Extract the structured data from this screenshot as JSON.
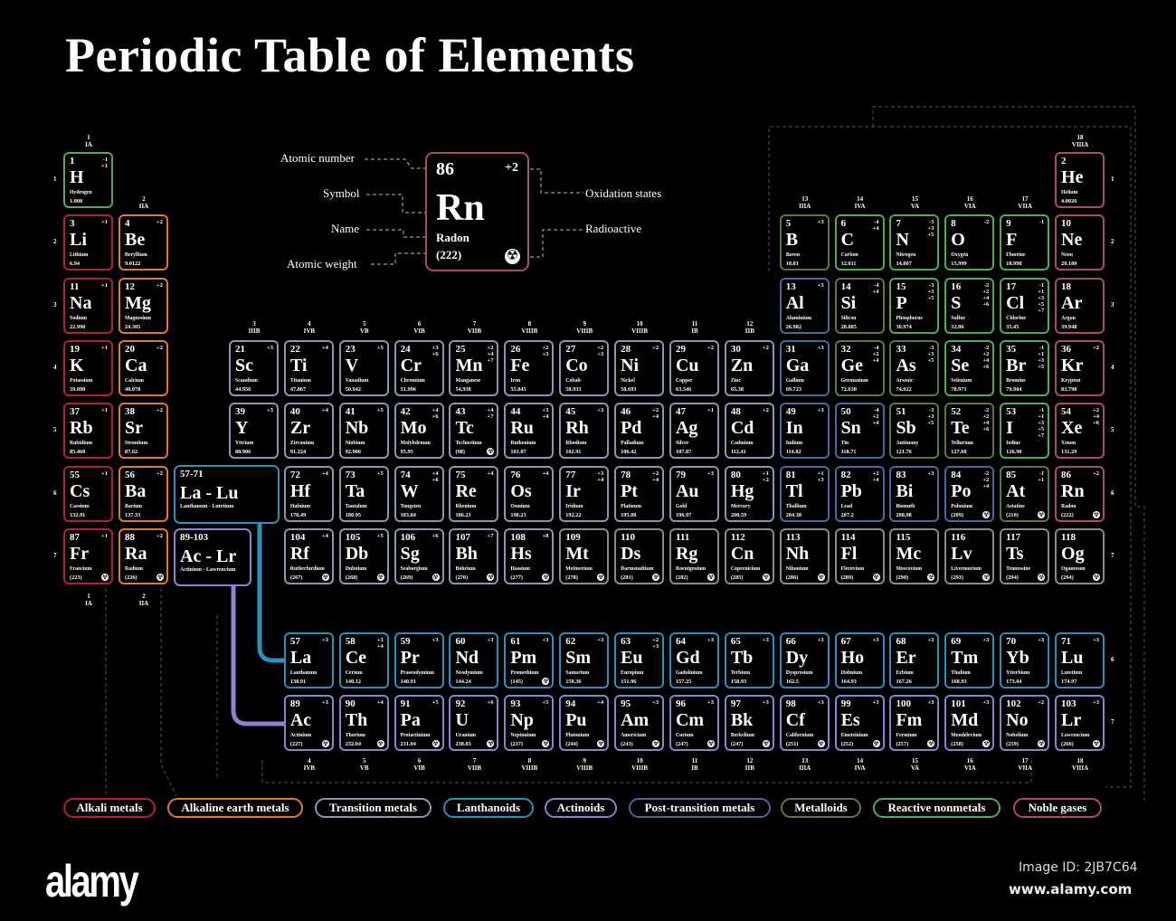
{
  "title": "Periodic Table of Elements",
  "colors": {
    "alkali": "#b3232f",
    "alkaline": "#e07a30",
    "transition": "#8898b4",
    "lanthanoid": "#2b8fbf",
    "actinoid": "#8a82d2",
    "post": "#46699f",
    "metalloid": "#5d7a3e",
    "nonmetal": "#4caf50",
    "noble": "#b04a66",
    "unknown": "#8a8a8a"
  },
  "key": {
    "number": "86",
    "oxidation": "+2",
    "symbol": "Rn",
    "name": "Radon",
    "weight": "(222)",
    "labels": {
      "atomic_number": "Atomic number",
      "symbol": "Symbol",
      "name": "Name",
      "atomic_weight": "Atomic weight",
      "oxidation_states": "Oxidation states",
      "radioactive": "Radioactive"
    },
    "radioactive_icon": "radiation-icon"
  },
  "groups": [
    {
      "n": "1",
      "r": "IA"
    },
    {
      "n": "2",
      "r": "IIA"
    },
    {
      "n": "3",
      "r": "IIIB"
    },
    {
      "n": "4",
      "r": "IVB"
    },
    {
      "n": "5",
      "r": "VB"
    },
    {
      "n": "6",
      "r": "VIB"
    },
    {
      "n": "7",
      "r": "VIIB"
    },
    {
      "n": "8",
      "r": "VIIIB"
    },
    {
      "n": "9",
      "r": "VIIIB"
    },
    {
      "n": "10",
      "r": "VIIIB"
    },
    {
      "n": "11",
      "r": "IB"
    },
    {
      "n": "12",
      "r": "IIB"
    },
    {
      "n": "13",
      "r": "IIIA"
    },
    {
      "n": "14",
      "r": "IVA"
    },
    {
      "n": "15",
      "r": "VA"
    },
    {
      "n": "16",
      "r": "VIA"
    },
    {
      "n": "17",
      "r": "VIIA"
    },
    {
      "n": "18",
      "r": "VIIIA"
    }
  ],
  "periods": [
    "1",
    "2",
    "3",
    "4",
    "5",
    "6",
    "7"
  ],
  "series_periods": [
    "6",
    "7"
  ],
  "placeholders": [
    {
      "range": "57-71",
      "symbol": "La - Lu",
      "name": "Lanthanum - Lutetium",
      "cat": "lanthanoid"
    },
    {
      "range": "89-103",
      "symbol": "Ac - Lr",
      "name": "Actinium - Lawrencium",
      "cat": "actinoid"
    }
  ],
  "elements": [
    "1|H|Hydrogen|1.008|-1 +1|nonmetal|0",
    "2|He|Helium|4.0026||noble|0",
    "3|Li|Lithium|6.94|+1|alkali|0",
    "4|Be|Beryllium|9.0122|+2|alkaline|0",
    "5|B|Boron|10.81|+3|metalloid|0",
    "6|C|Carbon|12.011|-4 +4|nonmetal|0",
    "7|N|Nitrogen|14.007|-3 +3 +5|nonmetal|0",
    "8|O|Oxygen|15.999|-2|nonmetal|0",
    "9|F|Fluorine|18.998|-1|nonmetal|0",
    "10|Ne|Neon|20.180||noble|0",
    "11|Na|Sodium|22.990|+1|alkali|0",
    "12|Mg|Magnesium|24.305|+2|alkaline|0",
    "13|Al|Aluminium|26.982|+3|post|0",
    "14|Si|Silicon|28.085|-4 +4|metalloid|0",
    "15|P|Phosphorus|30.974|-3 +3 +5|nonmetal|0",
    "16|S|Sulfur|32.06|-2 +2 +4 +6|nonmetal|0",
    "17|Cl|Chlorine|35.45|-1 +1 +3 +5 +7|nonmetal|0",
    "18|Ar|Argon|39.948||noble|0",
    "19|K|Potassium|39.098|+1|alkali|0",
    "20|Ca|Calcium|40.078|+2|alkaline|0",
    "21|Sc|Scandium|44.956|+3|transition|0",
    "22|Ti|Titanium|47.867|+4|transition|0",
    "23|V|Vanadium|50.942|+5|transition|0",
    "24|Cr|Chromium|51.996|+3 +6|transition|0",
    "25|Mn|Manganese|54.938|+2 +4 +7|transition|0",
    "26|Fe|Iron|55.845|+2 +3|transition|0",
    "27|Co|Cobalt|58.933|+2 +3|transition|0",
    "28|Ni|Nickel|58.693|+2|transition|0",
    "29|Cu|Copper|63.546|+2|transition|0",
    "30|Zn|Zinc|65.38|+2|transition|0",
    "31|Ga|Gallium|69.723|+3|post|0",
    "32|Ge|Germanium|72.630|-4 +2 +4|metalloid|0",
    "33|As|Arsenic|74.922|-3 +3 +5|metalloid|0",
    "34|Se|Selenium|78.971|-2 +2 +4 +6|nonmetal|0",
    "35|Br|Bromine|79.904|-1 +1 +3 +5|nonmetal|0",
    "36|Kr|Krypton|83.798|+2|noble|0",
    "37|Rb|Rubidium|85.468|+1|alkali|0",
    "38|Sr|Strontium|87.62|+2|alkaline|0",
    "39|Y|Yttrium|88.906|+3|transition|0",
    "40|Zr|Zirconium|91.224|+4|transition|0",
    "41|Nb|Niobium|92.906|+5|transition|0",
    "42|Mo|Molybdenum|95.95|+4 +6|transition|0",
    "43|Tc|Technetium|(98)|+4 +7|transition|1",
    "44|Ru|Ruthenium|101.07|+3 +4|transition|0",
    "45|Rh|Rhodium|102.91|+3|transition|0",
    "46|Pd|Palladium|106.42|+2 +4|transition|0",
    "47|Ag|Silver|107.87|+1|transition|0",
    "48|Cd|Cadmium|112.41|+2|transition|0",
    "49|In|Indium|114.82|+3|post|0",
    "50|Sn|Tin|118.71|-4 +2 +4|post|0",
    "51|Sb|Antimony|121.76|-3 +3 +5|metalloid|0",
    "52|Te|Tellurium|127.60|-2 +2 +4 +6|metalloid|0",
    "53|I|Iodine|126.90|-1 +1 +3 +5 +7|nonmetal|0",
    "54|Xe|Xenon|131.29|+2 +4 +6|noble|0",
    "55|Cs|Caesium|132.91|+1|alkali|0",
    "56|Ba|Barium|137.33|+2|alkaline|0",
    "57|La|Lanthanum|138.91|+3|lanthanoid|0",
    "58|Ce|Cerium|140.12|+3 +4|lanthanoid|0",
    "59|Pr|Praseodymium|140.91|+3|lanthanoid|0",
    "60|Nd|Neodymium|144.24|+3|lanthanoid|0",
    "61|Pm|Promethium|(145)|+3|lanthanoid|1",
    "62|Sm|Samarium|150.36|+3|lanthanoid|0",
    "63|Eu|Europium|151.96|+2 +3|lanthanoid|0",
    "64|Gd|Gadolinium|157.25|+3|lanthanoid|0",
    "65|Tb|Terbium|158.93|+3|lanthanoid|0",
    "66|Dy|Dysprosium|162.5|+3|lanthanoid|0",
    "67|Ho|Holmium|164.93|+3|lanthanoid|0",
    "68|Er|Erbium|167.26|+3|lanthanoid|0",
    "69|Tm|Thulium|168.93|+3|lanthanoid|0",
    "70|Yb|Ytterbium|173.04|+3|lanthanoid|0",
    "71|Lu|Lutetium|174.97|+3|lanthanoid|0",
    "72|Hf|Hafnium|178.49|+4|transition|0",
    "73|Ta|Tantalum|180.95|+5|transition|0",
    "74|W|Tungsten|183.84|+4 +6|transition|0",
    "75|Re|Rhenium|186.21|+4|transition|0",
    "76|Os|Osmium|190.23|+4|transition|0",
    "77|Ir|Iridium|192.22|+3 +4|transition|0",
    "78|Pt|Platinum|195.08|+2 +4|transition|0",
    "79|Au|Gold|196.97|+3|transition|0",
    "80|Hg|Mercury|200.59|+1 +2|transition|0",
    "81|Tl|Thallium|204.38|+1 +3|post|0",
    "82|Pb|Lead|207.2|+2 +4|post|0",
    "83|Bi|Bismuth|208.98|+3|post|0",
    "84|Po|Polonium|(209)|-2 +2 +4|post|1",
    "85|At|Astatine|(210)|-1 +1|metalloid|1",
    "86|Rn|Radon|(222)|+2|noble|1",
    "87|Fr|Francium|(223)|+1|alkali|1",
    "88|Ra|Radium|(226)|+2|alkaline|1",
    "89|Ac|Actinium|(227)|+3|actinoid|1",
    "90|Th|Thorium|232.04|+4|actinoid|1",
    "91|Pa|Protactinium|231.04|+5|actinoid|1",
    "92|U|Uranium|238.03|+6|actinoid|1",
    "93|Np|Neptunium|(237)|+5|actinoid|1",
    "94|Pu|Plutonium|(244)|+4|actinoid|1",
    "95|Am|Americium|(243)|+3|actinoid|1",
    "96|Cm|Curium|(247)|+3|actinoid|1",
    "97|Bk|Berkelium|(247)|+3|actinoid|1",
    "98|Cf|Californium|(251)|+3|actinoid|1",
    "99|Es|Einsteinium|(252)|+3|actinoid|1",
    "100|Fm|Fermium|(257)|+3|actinoid|1",
    "101|Md|Mendelevium|(258)|+3|actinoid|1",
    "102|No|Nobelium|(259)|+2|actinoid|1",
    "103|Lr|Lawrencium|(266)|+3|actinoid|1",
    "104|Rf|Rutherfordium|(267)|+4|transition|1",
    "105|Db|Dubnium|(268)|+5|transition|1",
    "106|Sg|Seaborgium|(269)|+6|transition|1",
    "107|Bh|Bohrium|(270)|+7|transition|1",
    "108|Hs|Hassium|(277)|+8|transition|1",
    "109|Mt|Meitnerium|(278)||unknown|1",
    "110|Ds|Darmstadtium|(281)||unknown|1",
    "111|Rg|Roentgenium|(282)||unknown|1",
    "112|Cn|Copernicium|(285)||unknown|1",
    "113|Nh|Nihonium|(286)||unknown|1",
    "114|Fl|Flerovium|(289)||unknown|1",
    "115|Mc|Moscovium|(290)||unknown|1",
    "116|Lv|Livermorium|(293)||unknown|1",
    "117|Ts|Tennessine|(294)||unknown|1",
    "118|Og|Oganesson|(294)||unknown|1"
  ],
  "legend": [
    {
      "label": "Alkali metals",
      "cat": "alkali"
    },
    {
      "label": "Alkaline earth metals",
      "cat": "alkaline"
    },
    {
      "label": "Transition metals",
      "cat": "transition"
    },
    {
      "label": "Lanthanoids",
      "cat": "lanthanoid"
    },
    {
      "label": "Actinoids",
      "cat": "actinoid"
    },
    {
      "label": "Post-transition metals",
      "cat": "post"
    },
    {
      "label": "Metalloids",
      "cat": "metalloid"
    },
    {
      "label": "Reactive nonmetals",
      "cat": "nonmetal"
    },
    {
      "label": "Noble gases",
      "cat": "noble"
    }
  ],
  "footer": {
    "logo": "alamy",
    "image_id": "Image ID: 2JB7C64",
    "site": "www.alamy.com"
  }
}
